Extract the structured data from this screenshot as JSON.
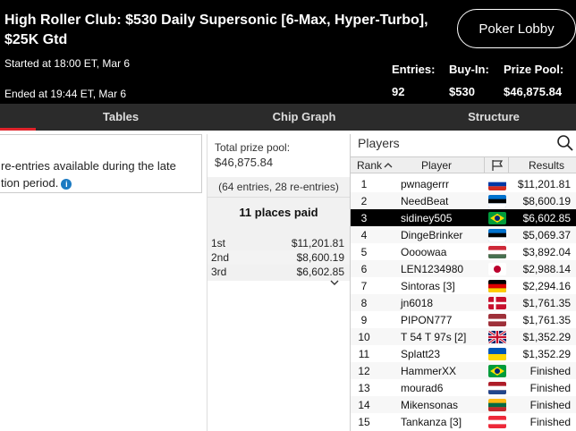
{
  "header": {
    "title": "High Roller Club: $530 Daily Supersonic [6-Max, Hyper-Turbo], $25K Gtd",
    "started": "Started at 18:00 ET, Mar 6",
    "ended": "Ended at 19:44 ET, Mar 6",
    "lobby_button": "Poker Lobby",
    "entries_label": "Entries:",
    "entries_value": "92",
    "buyin_label": "Buy-In:",
    "buyin_value": "$530",
    "prizepool_label": "Prize Pool:",
    "prizepool_value": "$46,875.84"
  },
  "tabs": [
    {
      "label": "Tables",
      "active": true
    },
    {
      "label": "Chip Graph",
      "active": false
    },
    {
      "label": "Structure",
      "active": false
    }
  ],
  "info": {
    "line1": "re-entries available during the late",
    "line2": "tion period.",
    "icon": "info-icon"
  },
  "prize": {
    "label": "Total prize pool:",
    "value": "$46,875.84",
    "entries_note": "(64 entries, 28 re-entries)",
    "places_paid": "11 places paid",
    "payouts": [
      {
        "place": "1st",
        "amount": "$11,201.81"
      },
      {
        "place": "2nd",
        "amount": "$8,600.19"
      },
      {
        "place": "3rd",
        "amount": "$6,602.85"
      }
    ]
  },
  "players": {
    "title": "Players",
    "columns": {
      "rank": "Rank",
      "player": "Player",
      "results": "Results"
    },
    "sort_icon": "chevron-up-icon",
    "flag_column_icon": "flag-icon",
    "rows": [
      {
        "rank": "1",
        "name": "pwnagerrr",
        "flag": "russia",
        "result": "$11,201.81"
      },
      {
        "rank": "2",
        "name": "NeedBeat",
        "flag": "estonia",
        "result": "$8,600.19"
      },
      {
        "rank": "3",
        "name": "sidiney505",
        "flag": "brazil",
        "result": "$6,602.85",
        "selected": true
      },
      {
        "rank": "4",
        "name": "DingeBrinker",
        "flag": "estonia",
        "result": "$5,069.37"
      },
      {
        "rank": "5",
        "name": "Oooowaa",
        "flag": "hungary",
        "result": "$3,892.04"
      },
      {
        "rank": "6",
        "name": "LEN1234980",
        "flag": "japan",
        "result": "$2,988.14"
      },
      {
        "rank": "7",
        "name": "Sintoras [3]",
        "flag": "germany",
        "result": "$2,294.16"
      },
      {
        "rank": "8",
        "name": "jn6018",
        "flag": "denmark",
        "result": "$1,761.35"
      },
      {
        "rank": "9",
        "name": "PIPON777",
        "flag": "latvia",
        "result": "$1,761.35"
      },
      {
        "rank": "10",
        "name": "T 54 T 97s [2]",
        "flag": "uk",
        "result": "$1,352.29"
      },
      {
        "rank": "11",
        "name": "Splatt23",
        "flag": "ukraine",
        "result": "$1,352.29"
      },
      {
        "rank": "12",
        "name": "HammerXX",
        "flag": "brazil",
        "result": "Finished"
      },
      {
        "rank": "13",
        "name": "mourad6",
        "flag": "netherlands",
        "result": "Finished"
      },
      {
        "rank": "14",
        "name": "Mikensonas",
        "flag": "lithuania",
        "result": "Finished"
      },
      {
        "rank": "15",
        "name": "Tankanza [3]",
        "flag": "austria",
        "result": "Finished"
      }
    ]
  }
}
